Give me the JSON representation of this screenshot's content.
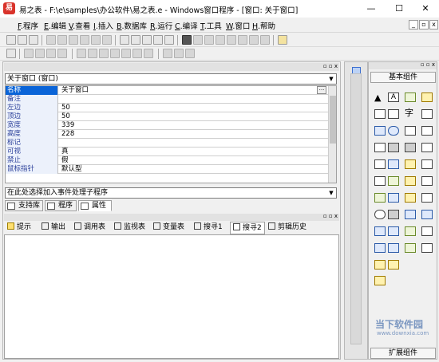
{
  "window": {
    "title": "易之表 - F:\\e\\samples\\办公软件\\易之表.e - Windows窗口程序 - [窗口: 关于窗口]",
    "logo_text": "易",
    "min_symbol": "—",
    "max_symbol": "☐",
    "close_symbol": "✕"
  },
  "menu": [
    {
      "key": "F",
      "label": ".程序"
    },
    {
      "key": "E",
      "label": ".编辑"
    },
    {
      "key": "V",
      "label": ".查看"
    },
    {
      "key": "I",
      "label": ".插入"
    },
    {
      "key": "B",
      "label": ".数据库"
    },
    {
      "key": "R",
      "label": ".运行"
    },
    {
      "key": "C",
      "label": ".编译"
    },
    {
      "key": "T",
      "label": ".工具"
    },
    {
      "key": "W",
      "label": ".窗口"
    },
    {
      "key": "H",
      "label": ".帮助"
    }
  ],
  "properties": {
    "selector_value": "关于窗口 (窗口)",
    "rows": [
      {
        "name": "名称",
        "value": "关于窗口"
      },
      {
        "name": "备注",
        "value": ""
      },
      {
        "name": "左边",
        "value": "50"
      },
      {
        "name": "顶边",
        "value": "50"
      },
      {
        "name": "宽度",
        "value": "339"
      },
      {
        "name": "高度",
        "value": "228"
      },
      {
        "name": "标记",
        "value": ""
      },
      {
        "name": "可视",
        "value": "真"
      },
      {
        "name": "禁止",
        "value": "假"
      },
      {
        "name": "鼠标指针",
        "value": "默认型"
      }
    ],
    "event_selector": "在此处选择加入事件处理子程序",
    "ellipsis": "···"
  },
  "left_tabs": [
    {
      "label": "支持库"
    },
    {
      "label": "程序"
    },
    {
      "label": "属性",
      "active": true
    }
  ],
  "output_tabs": [
    "提示",
    "输出",
    "调用表",
    "监视表",
    "变量表",
    "搜寻1",
    "搜寻2",
    "剪辑历史"
  ],
  "components": {
    "header": "基本组件",
    "footer": "扩展组件",
    "pointer": "▲",
    "label_glyph": "A",
    "text_glyph": "字"
  },
  "watermark": {
    "text_cn": "当下软件园",
    "text_en": "www.downxia.com",
    "color": "#1a4d9a"
  }
}
